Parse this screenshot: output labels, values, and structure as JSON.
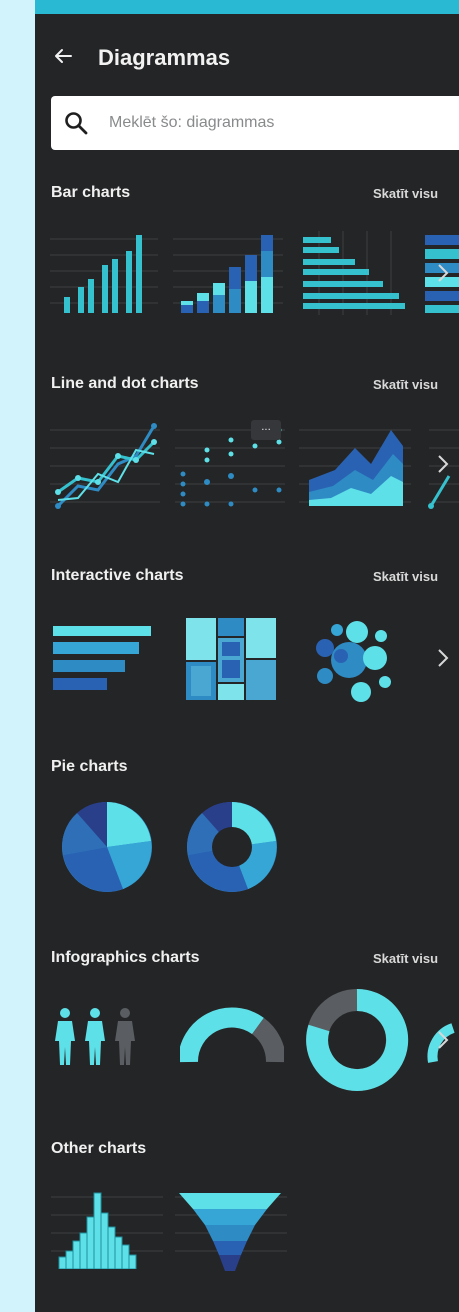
{
  "header": {
    "title": "Diagrammas",
    "back_icon": "back-arrow-icon"
  },
  "search": {
    "placeholder": "Meklēt šo: diagrammas",
    "icon": "search-icon"
  },
  "sections": [
    {
      "title": "Bar charts",
      "see_all": "Skatīt visu"
    },
    {
      "title": "Line and dot charts",
      "see_all": "Skatīt visu"
    },
    {
      "title": "Interactive charts",
      "see_all": "Skatīt visu"
    },
    {
      "title": "Pie charts"
    },
    {
      "title": "Infographics charts",
      "see_all": "Skatīt visu"
    },
    {
      "title": "Other charts"
    }
  ],
  "thumbnails": {
    "bar": [
      "bar-chart",
      "stacked-bar-chart",
      "horizontal-bar-chart",
      "stacked-horizontal-bar-chart"
    ],
    "line": [
      "line-chart",
      "dot-plot",
      "area-chart",
      "slope-chart"
    ],
    "interactive": [
      "interactive-bar-chart",
      "treemap-chart",
      "bubble-chart"
    ],
    "pie": [
      "pie-chart",
      "donut-chart"
    ],
    "infographics": [
      "pictogram-chart",
      "gauge-chart",
      "progress-ring-chart",
      "radial-chart"
    ],
    "other": [
      "histogram-chart",
      "funnel-chart"
    ]
  },
  "thumbnail_menu_label": "···",
  "colors": {
    "panel": "#242526",
    "page": "#d2f3fb",
    "accent": "#2ab9d3",
    "light_cyan": "#5ee0e8",
    "mid_blue": "#2e8bc4",
    "dark_blue": "#2a3f8a",
    "grey": "#5a5d61"
  }
}
